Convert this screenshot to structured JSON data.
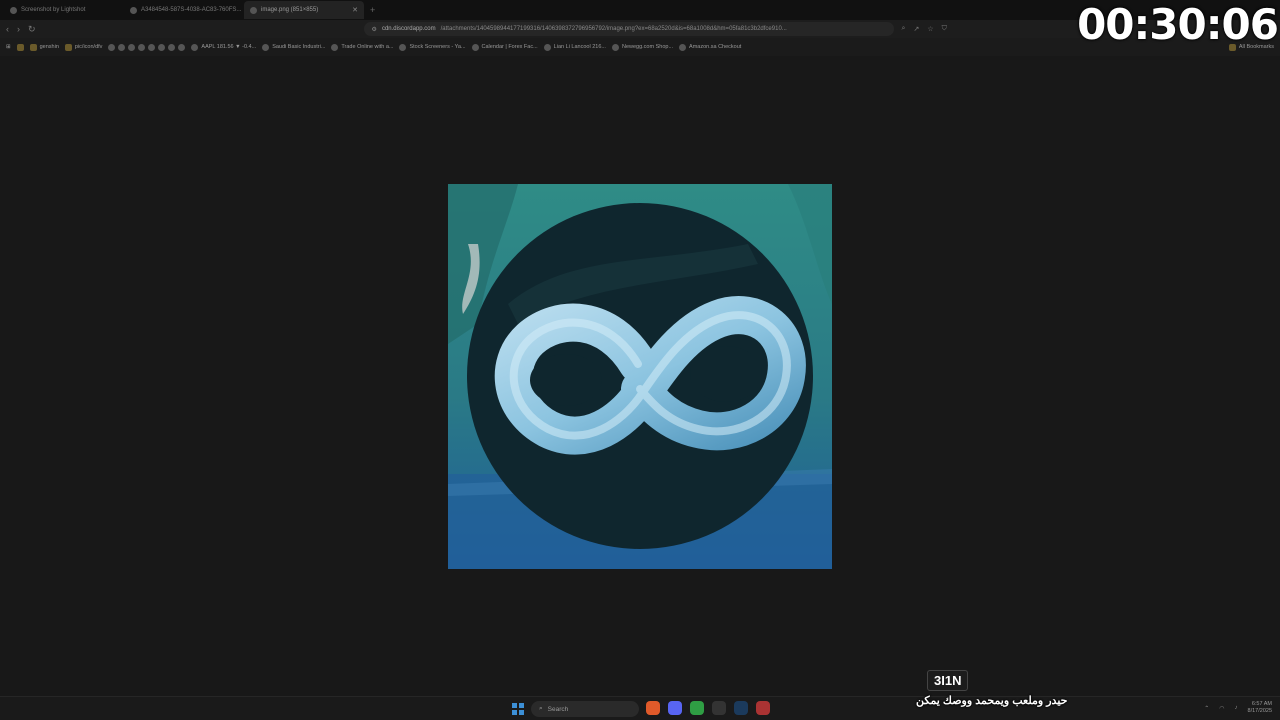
{
  "tabs": [
    {
      "label": "Screenshot by Lightshot"
    },
    {
      "label": "A3484548-587S-4038-AC83-760FS..."
    },
    {
      "label": "image.png (851×855)"
    }
  ],
  "toolbar": {
    "url_host": "cdn.discordapp.com",
    "url_path": "/attachments/1404598944177199316/1406398372796956792/image.png?ex=68a2520d&is=68a1008d&hm=05fa81c3b2dfce910..."
  },
  "bookmarks": [
    "genshin",
    "pic/icon/dfv",
    "AAPL 181.56 ▼ -0.4...",
    "Saudi Basic Industri...",
    "Trade Online with a...",
    "Stock Screeners - Ya...",
    "Calendar | Forex Fac...",
    "Lian Li Lancool 216...",
    "Newegg.com Shop...",
    "Amazon.sa Checkout"
  ],
  "bookmarks_right": "All Bookmarks",
  "overlay": {
    "timer": "00:30:06",
    "badge": "3I1N",
    "caption": "حيدر وملعب ويمحمد ووصك يمكن"
  },
  "taskbar": {
    "search_placeholder": "Search",
    "time": "6:57 AM",
    "date": "8/17/2025"
  },
  "colors": {
    "page_bg": "#181818",
    "logo_ribbon": "#8cc4e0",
    "logo_circle": "#0f262e",
    "photo_teal": "#2f8c86",
    "photo_blue": "#1f5e98"
  }
}
